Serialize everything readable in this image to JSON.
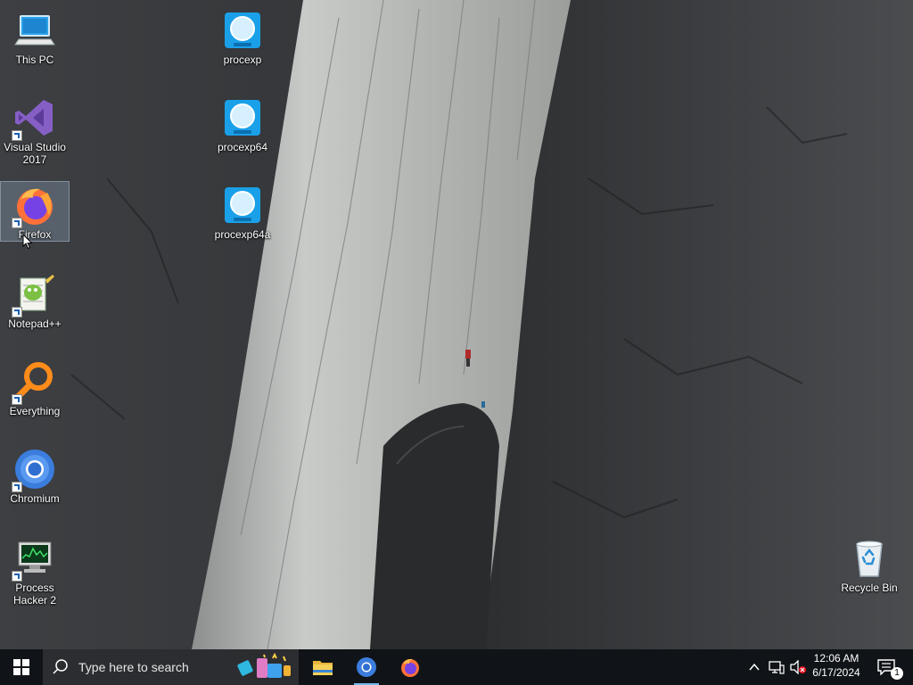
{
  "desktop": {
    "icons": [
      {
        "label": "This PC",
        "icon": "computer-icon"
      },
      {
        "label": "Visual Studio\n2017",
        "icon": "visual-studio-icon"
      },
      {
        "label": "Firefox",
        "icon": "firefox-icon"
      },
      {
        "label": "Notepad++",
        "icon": "notepad-plus-plus-icon"
      },
      {
        "label": "Everything",
        "icon": "everything-search-icon"
      },
      {
        "label": "Chromium",
        "icon": "chromium-icon"
      },
      {
        "label": "Process\nHacker 2",
        "icon": "process-hacker-icon"
      },
      {
        "label": "procexp",
        "icon": "procexp-icon"
      },
      {
        "label": "procexp64",
        "icon": "procexp-icon"
      },
      {
        "label": "procexp64a",
        "icon": "procexp-icon"
      },
      {
        "label": "Recycle Bin",
        "icon": "recycle-bin-icon"
      }
    ],
    "selected_icon": "Firefox"
  },
  "taskbar": {
    "search_placeholder": "Type here to search",
    "pinned": [
      {
        "name": "File Explorer",
        "icon": "folder-icon"
      },
      {
        "name": "Chromium",
        "icon": "chromium-icon"
      },
      {
        "name": "Firefox",
        "icon": "firefox-icon"
      }
    ],
    "clock_time": "12:06 AM",
    "clock_date": "6/17/2024",
    "notification_count": "1"
  },
  "colors": {
    "taskbar_bg": "#101418",
    "search_bg": "#2b2d31",
    "accent": "#76b9ed"
  }
}
